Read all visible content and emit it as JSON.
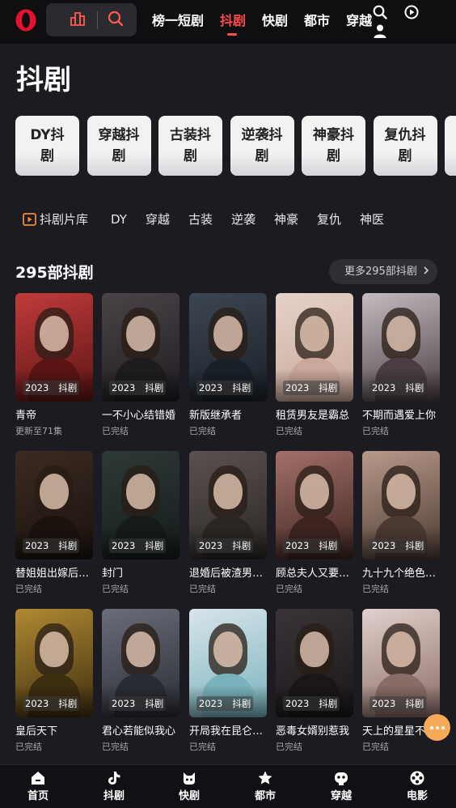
{
  "header": {
    "nav": [
      "榜一短剧",
      "抖剧",
      "快剧",
      "都市",
      "穿越"
    ],
    "active_nav": "抖剧",
    "icons": [
      "opera-logo",
      "ranking-icon",
      "search-icon",
      "play-icon",
      "user-icon"
    ]
  },
  "page_title": "抖剧",
  "categories": [
    {
      "label": "DY抖剧"
    },
    {
      "label": "穿越抖剧"
    },
    {
      "label": "古装抖剧"
    },
    {
      "label": "逆袭抖剧"
    },
    {
      "label": "神豪抖剧"
    },
    {
      "label": "复仇抖剧"
    }
  ],
  "filters": [
    "抖剧片库",
    "DY",
    "穿越",
    "古装",
    "逆袭",
    "神豪",
    "复仇",
    "神医"
  ],
  "section": {
    "title": "295部抖剧",
    "more": "更多295部抖剧"
  },
  "cards": [
    {
      "year": "2023",
      "tag": "抖剧",
      "title": "青帝",
      "status": "更新至71集",
      "color1": "#c23b3b",
      "color2": "#5a1414"
    },
    {
      "year": "2023",
      "tag": "抖剧",
      "title": "一不小心结错婚",
      "status": "已完结",
      "color1": "#4a4448",
      "color2": "#1f1c20"
    },
    {
      "year": "2023",
      "tag": "抖剧",
      "title": "新版继承者",
      "status": "已完结",
      "color1": "#3c4652",
      "color2": "#1a2028"
    },
    {
      "year": "2023",
      "tag": "抖剧",
      "title": "租赁男友是霸总",
      "status": "已完结",
      "color1": "#e6d2c8",
      "color2": "#c9a79a"
    },
    {
      "year": "2023",
      "tag": "抖剧",
      "title": "不期而遇爱上你",
      "status": "已完结",
      "color1": "#c4bcc0",
      "color2": "#4a3d44"
    },
    {
      "year": "2023",
      "tag": "抖剧",
      "title": "替姐姐出嫁后…",
      "status": "已完结",
      "color1": "#3b2a22",
      "color2": "#1b120e"
    },
    {
      "year": "2023",
      "tag": "抖剧",
      "title": "封门",
      "status": "已完结",
      "color1": "#2e3a38",
      "color2": "#141b1a"
    },
    {
      "year": "2023",
      "tag": "抖剧",
      "title": "退婚后被渣男…",
      "status": "已完结",
      "color1": "#5a5250",
      "color2": "#2a2624"
    },
    {
      "year": "2023",
      "tag": "抖剧",
      "title": "顾总夫人又要…",
      "status": "已完结",
      "color1": "#a4706a",
      "color2": "#3d2420"
    },
    {
      "year": "2023",
      "tag": "抖剧",
      "title": "九十九个绝色…",
      "status": "已完结",
      "color1": "#b89a8a",
      "color2": "#4c3a32"
    },
    {
      "year": "2023",
      "tag": "抖剧",
      "title": "皇后天下",
      "status": "已完结",
      "color1": "#b08a32",
      "color2": "#3e2e10"
    },
    {
      "year": "2023",
      "tag": "抖剧",
      "title": "君心若能似我心",
      "status": "已完结",
      "color1": "#6a6e7a",
      "color2": "#2a2c34"
    },
    {
      "year": "2023",
      "tag": "抖剧",
      "title": "开局我在昆仑…",
      "status": "已完结",
      "color1": "#d8e4ea",
      "color2": "#7ab3bd"
    },
    {
      "year": "2023",
      "tag": "抖剧",
      "title": "恶毒女婿别惹我",
      "status": "已完结",
      "color1": "#3a3438",
      "color2": "#1a1618"
    },
    {
      "year": "2023",
      "tag": "抖剧",
      "title": "天上的星星不…",
      "status": "已完结",
      "color1": "#e2d0cc",
      "color2": "#8a6c66"
    }
  ],
  "bottom_tabs": [
    {
      "label": "首页",
      "icon": "home-icon"
    },
    {
      "label": "抖剧",
      "icon": "tiktok-icon"
    },
    {
      "label": "快剧",
      "icon": "kuai-icon"
    },
    {
      "label": "都市",
      "icon": "star-icon"
    },
    {
      "label": "穿越",
      "icon": "robot-icon"
    },
    {
      "label": "电影",
      "icon": "film-reel-icon"
    }
  ],
  "colors": {
    "accent": "#ff4d4d",
    "fab": "#f6a957",
    "background": "#1c1b21"
  }
}
